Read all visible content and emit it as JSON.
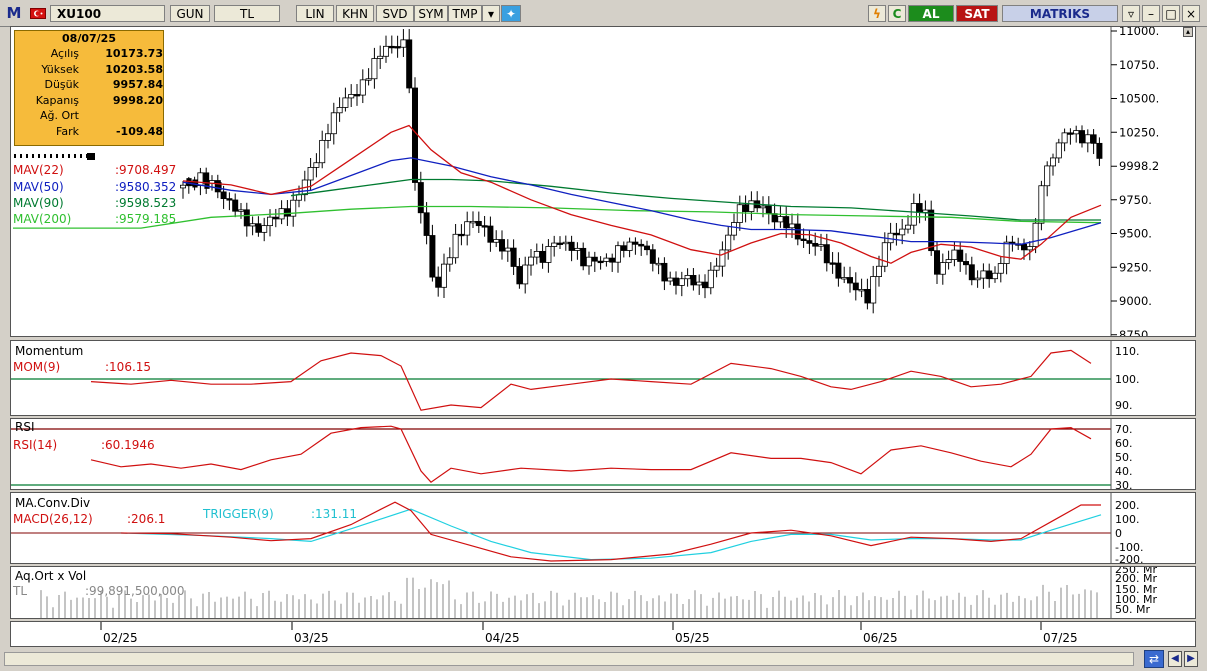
{
  "toolbar": {
    "logo": "M",
    "symbol": "XU100",
    "buttons": [
      "GUN",
      "TL",
      "LIN",
      "KHN",
      "SVD",
      "SYM",
      "TMP"
    ],
    "al": "AL",
    "sat": "SAT",
    "brand": "MATRIKS",
    "colors": {
      "al": "#1c8c1c",
      "sat": "#b81414",
      "brand": "#1a2a8c"
    }
  },
  "info": {
    "date": "08/07/25",
    "rows": [
      {
        "label": "Açılış",
        "value": "10173.73"
      },
      {
        "label": "Yüksek",
        "value": "10203.58"
      },
      {
        "label": "Düşük",
        "value": "9957.84"
      },
      {
        "label": "Kapanış",
        "value": "9998.20"
      },
      {
        "label": "Ağ. Ort",
        "value": ""
      },
      {
        "label": "Fark",
        "value": "-109.48"
      }
    ]
  },
  "main": {
    "indicators": [
      {
        "label": "MAV(22)",
        "value": ":9708.497",
        "color": "#d01010"
      },
      {
        "label": "MAV(50)",
        "value": ":9580.352",
        "color": "#1020c0"
      },
      {
        "label": "MAV(90)",
        "value": ":9598.523",
        "color": "#007a30"
      },
      {
        "label": "MAV(200)",
        "value": ":9579.185",
        "color": "#30c030"
      }
    ],
    "yticks": [
      "11000.",
      "10750.",
      "10500.",
      "10250.",
      "9998.2",
      "9750.",
      "9500.",
      "9250.",
      "9000.",
      "8750."
    ],
    "last_price": "9998.2"
  },
  "momentum": {
    "title": "Momentum",
    "label": "MOM(9)",
    "value": ":106.15",
    "yticks": [
      "110.",
      "100.",
      "90."
    ]
  },
  "rsi": {
    "title": "RSI",
    "label": "RSI(14)",
    "value": ":60.1946",
    "yticks": [
      "70.",
      "60.",
      "50.",
      "40.",
      "30."
    ]
  },
  "macd": {
    "title": "MA.Conv.Div",
    "label": "MACD(26,12)",
    "value": ":206.1",
    "trigger_label": "TRIGGER(9)",
    "trigger_value": ":131.11",
    "yticks": [
      "200.",
      "100.",
      "0",
      "-100.",
      "-200."
    ]
  },
  "volume": {
    "title": "Aq.Ort x Vol",
    "label": "TL",
    "value": ":99,891,500,000",
    "yticks": [
      "250. Mr",
      "200. Mr",
      "150. Mr",
      "100. Mr",
      "50. Mr"
    ]
  },
  "xaxis": [
    "02/25",
    "03/25",
    "04/25",
    "05/25",
    "06/25",
    "07/25"
  ]
}
